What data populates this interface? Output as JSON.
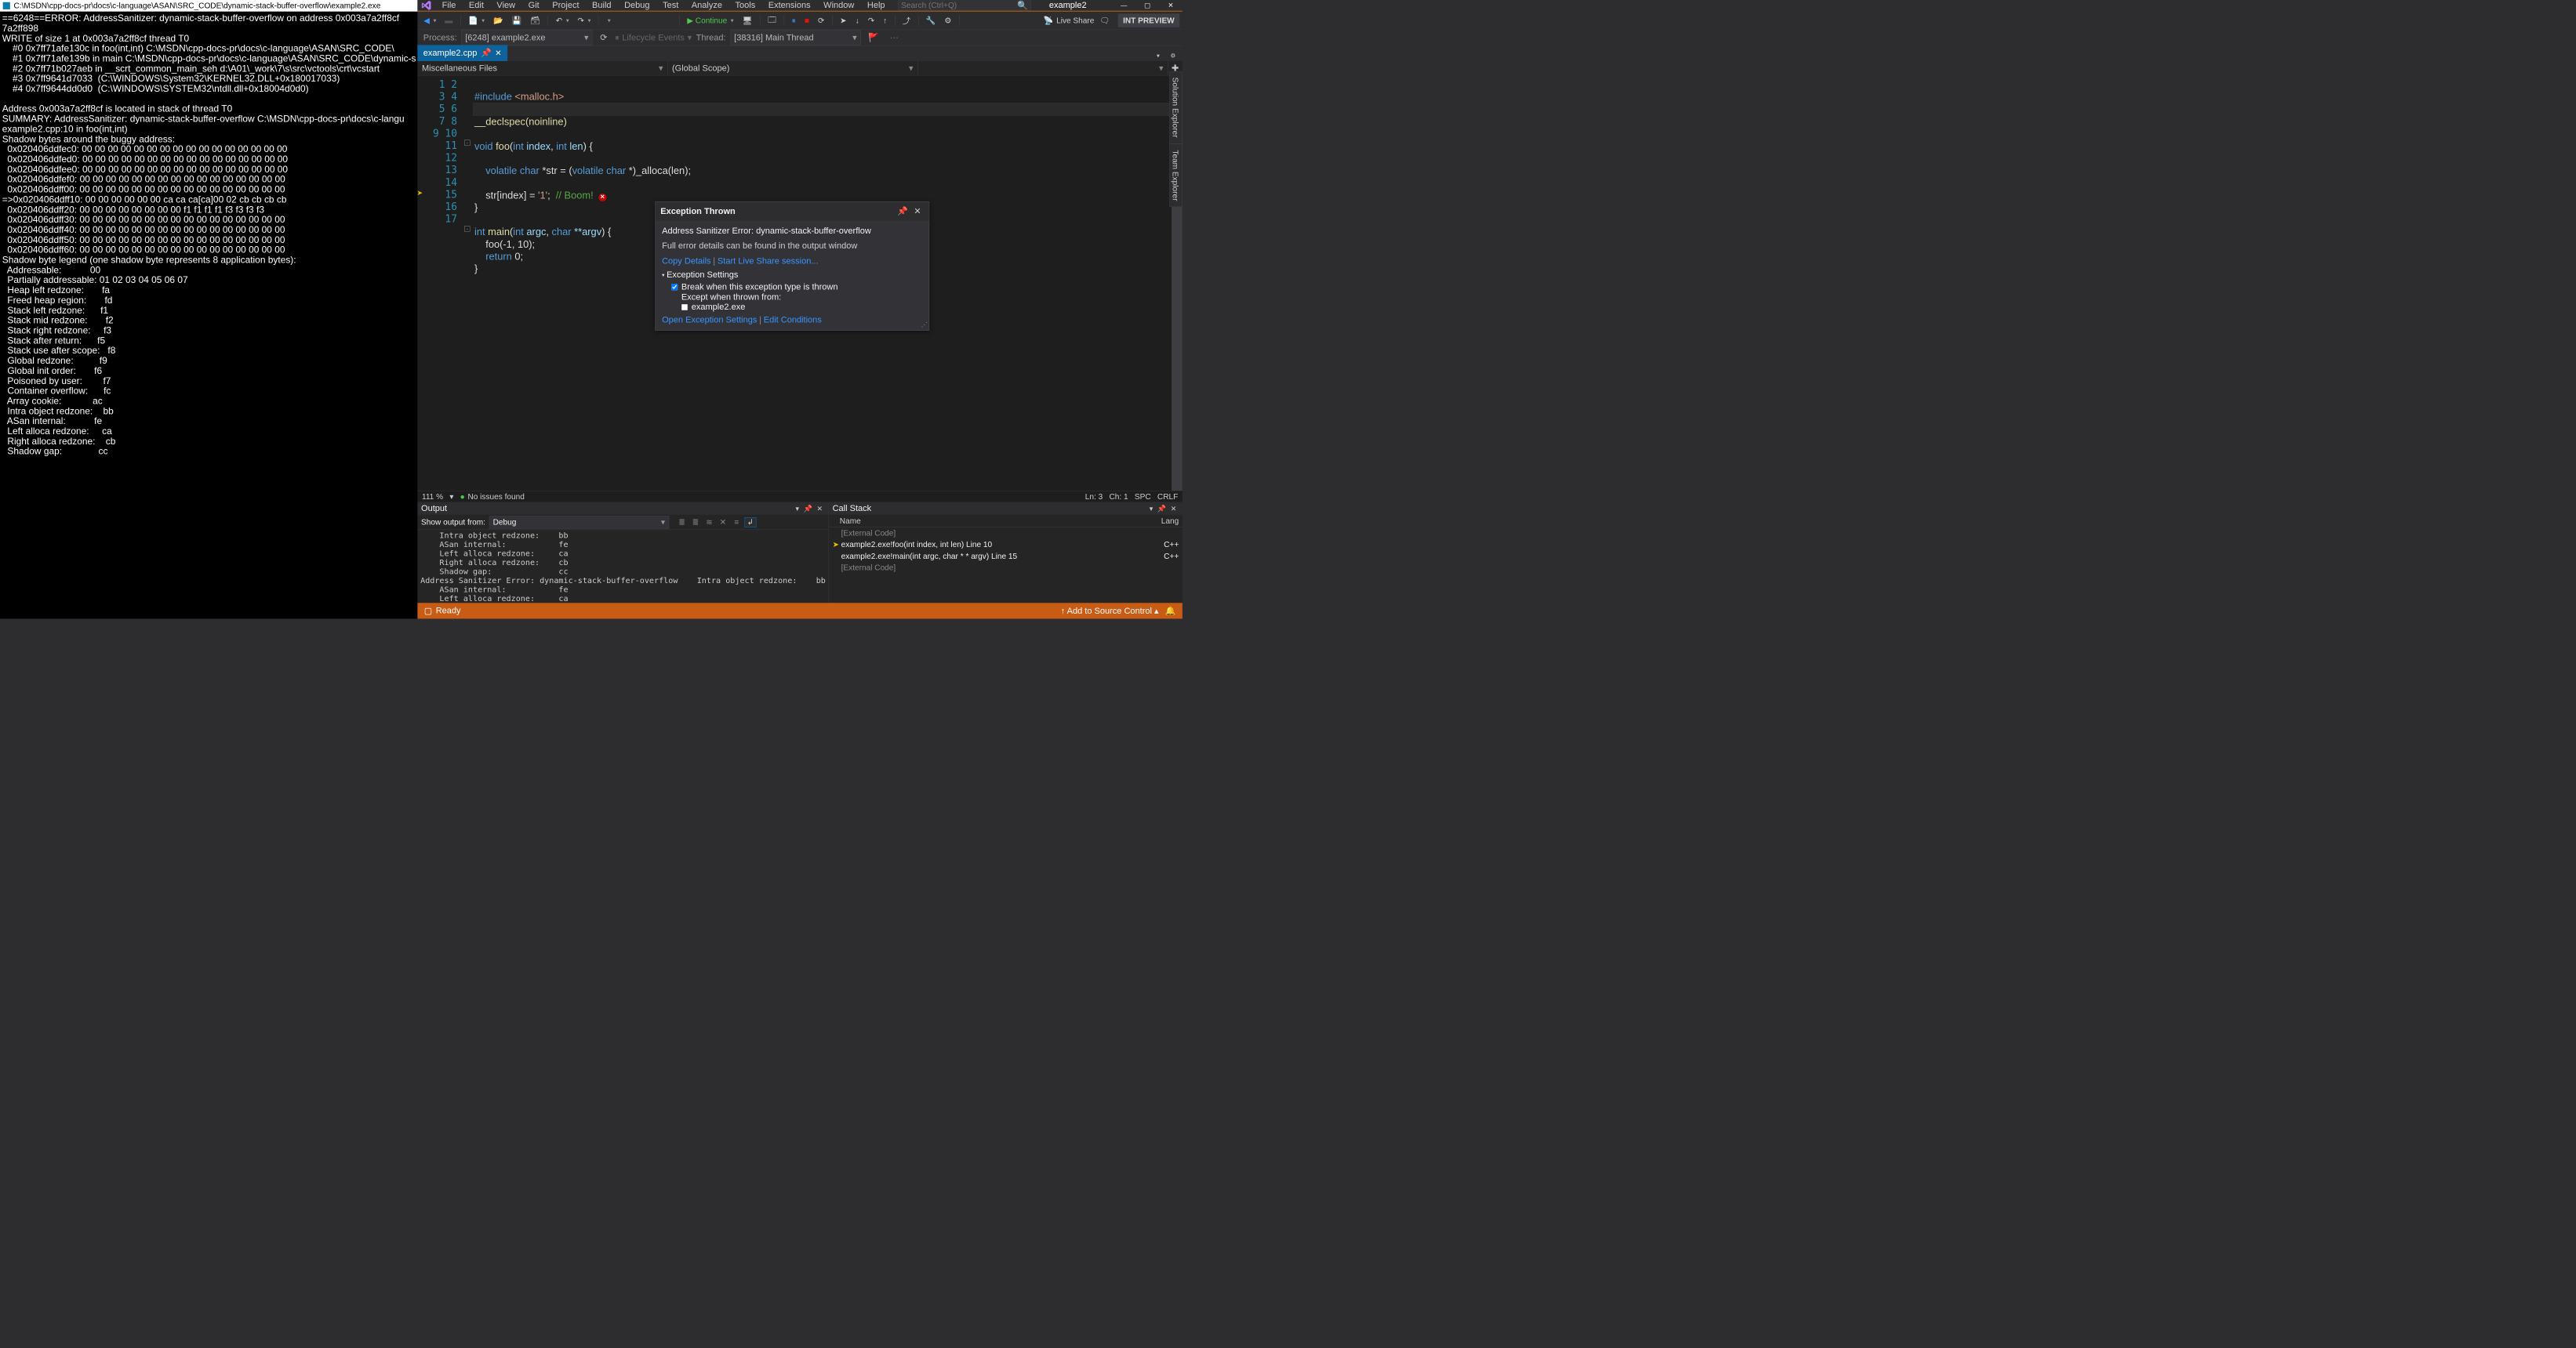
{
  "console": {
    "title": "C:\\MSDN\\cpp-docs-pr\\docs\\c-language\\ASAN\\SRC_CODE\\dynamic-stack-buffer-overflow\\example2.exe",
    "body": "==6248==ERROR: AddressSanitizer: dynamic-stack-buffer-overflow on address 0x003a7a2ff8cf\n7a2ff898\nWRITE of size 1 at 0x003a7a2ff8cf thread T0\n    #0 0x7ff71afe130c in foo(int,int) C:\\MSDN\\cpp-docs-pr\\docs\\c-language\\ASAN\\SRC_CODE\\\n    #1 0x7ff71afe139b in main C:\\MSDN\\cpp-docs-pr\\docs\\c-language\\ASAN\\SRC_CODE\\dynamic-s\n    #2 0x7ff71b027aeb in __scrt_common_main_seh d:\\A01\\_work\\7\\s\\src\\vctools\\crt\\vcstart\n    #3 0x7ff9641d7033  (C:\\WINDOWS\\System32\\KERNEL32.DLL+0x180017033)\n    #4 0x7ff9644dd0d0  (C:\\WINDOWS\\SYSTEM32\\ntdll.dll+0x18004d0d0)\n\nAddress 0x003a7a2ff8cf is located in stack of thread T0\nSUMMARY: AddressSanitizer: dynamic-stack-buffer-overflow C:\\MSDN\\cpp-docs-pr\\docs\\c-langu\nexample2.cpp:10 in foo(int,int)\nShadow bytes around the buggy address:\n  0x020406ddfec0: 00 00 00 00 00 00 00 00 00 00 00 00 00 00 00 00\n  0x020406ddfed0: 00 00 00 00 00 00 00 00 00 00 00 00 00 00 00 00\n  0x020406ddfee0: 00 00 00 00 00 00 00 00 00 00 00 00 00 00 00 00\n  0x020406ddfef0: 00 00 00 00 00 00 00 00 00 00 00 00 00 00 00 00\n  0x020406ddff00: 00 00 00 00 00 00 00 00 00 00 00 00 00 00 00 00\n=>0x020406ddff10: 00 00 00 00 00 00 ca ca ca[ca]00 02 cb cb cb cb\n  0x020406ddff20: 00 00 00 00 00 00 00 00 f1 f1 f1 f1 f3 f3 f3 f3\n  0x020406ddff30: 00 00 00 00 00 00 00 00 00 00 00 00 00 00 00 00\n  0x020406ddff40: 00 00 00 00 00 00 00 00 00 00 00 00 00 00 00 00\n  0x020406ddff50: 00 00 00 00 00 00 00 00 00 00 00 00 00 00 00 00\n  0x020406ddff60: 00 00 00 00 00 00 00 00 00 00 00 00 00 00 00 00\nShadow byte legend (one shadow byte represents 8 application bytes):\n  Addressable:           00\n  Partially addressable: 01 02 03 04 05 06 07\n  Heap left redzone:       fa\n  Freed heap region:       fd\n  Stack left redzone:      f1\n  Stack mid redzone:       f2\n  Stack right redzone:     f3\n  Stack after return:      f5\n  Stack use after scope:   f8\n  Global redzone:          f9\n  Global init order:       f6\n  Poisoned by user:        f7\n  Container overflow:      fc\n  Array cookie:            ac\n  Intra object redzone:    bb\n  ASan internal:           fe\n  Left alloca redzone:     ca\n  Right alloca redzone:    cb\n  Shadow gap:              cc"
  },
  "titlebar": {
    "menus": [
      "File",
      "Edit",
      "View",
      "Git",
      "Project",
      "Build",
      "Debug",
      "Test",
      "Analyze",
      "Tools",
      "Extensions",
      "Window",
      "Help"
    ],
    "search_placeholder": "Search (Ctrl+Q)",
    "window_title": "example2",
    "int_preview": "INT PREVIEW",
    "live_share": "Live Share"
  },
  "toolbar": {
    "continue": "Continue"
  },
  "debugbar": {
    "process_label": "Process:",
    "process_value": "[6248] example2.exe",
    "lifecycle": "Lifecycle Events",
    "thread_label": "Thread:",
    "thread_value": "[38316] Main Thread"
  },
  "tabs": {
    "doc": "example2.cpp"
  },
  "navbar": {
    "left": "Miscellaneous Files",
    "mid": "(Global Scope)",
    "right": ""
  },
  "code": {
    "lines": 17,
    "l2_inc": "#include",
    "l2_file": "<malloc.h>",
    "l4": "__declspec(noinline)",
    "l6_void": "void",
    "l6_foo": "foo",
    "l6_int1": "int",
    "l6_p1": "index",
    "l6_int2": "int",
    "l6_p2": "len",
    "l8_vc": "volatile char",
    "l8_str": "*str = (",
    "l8_vc2": "volatile char",
    "l8_rest": " *)_alloca(len);",
    "l10_a": "str[index] = ",
    "l10_s": "'1'",
    "l10_b": ";",
    "l10_c": "// Boom!",
    "l13_int": "int",
    "l13_main": "main",
    "l13_int2": "int",
    "l13_argc": "argc",
    "l13_char": "char",
    "l13_argv": "**argv",
    "l14": "foo(-1, 10);",
    "l15_ret": "return",
    "l15_v": " 0;"
  },
  "exception": {
    "title": "Exception Thrown",
    "error": "Address Sanitizer Error: dynamic-stack-buffer-overflow",
    "info": "Full error details can be found in the output window",
    "link_copy": "Copy Details",
    "link_live": "Start Live Share session...",
    "settings_title": "Exception Settings",
    "break_label": "Break when this exception type is thrown",
    "except_label": "Except when thrown from:",
    "except_module": "example2.exe",
    "link_open": "Open Exception Settings",
    "link_edit": "Edit Conditions"
  },
  "status": {
    "zoom": "111 %",
    "issues": "No issues found",
    "ln": "Ln: 3",
    "ch": "Ch: 1",
    "spc": "SPC",
    "crlf": "CRLF"
  },
  "output": {
    "title": "Output",
    "from_label": "Show output from:",
    "from_value": "Debug",
    "body": "    Intra object redzone:    bb\n    ASan internal:           fe\n    Left alloca redzone:     ca\n    Right alloca redzone:    cb\n    Shadow gap:              cc\nAddress Sanitizer Error: dynamic-stack-buffer-overflow"
  },
  "callstack": {
    "title": "Call Stack",
    "col_name": "Name",
    "col_lang": "Lang",
    "rows": [
      {
        "name": "[External Code]",
        "lang": "",
        "grey": true,
        "arrow": false
      },
      {
        "name": "example2.exe!foo(int index, int len) Line 10",
        "lang": "C++",
        "grey": false,
        "arrow": true
      },
      {
        "name": "example2.exe!main(int argc, char * * argv) Line 15",
        "lang": "C++",
        "grey": false,
        "arrow": false
      },
      {
        "name": "[External Code]",
        "lang": "",
        "grey": true,
        "arrow": false
      }
    ]
  },
  "footer": {
    "ready": "Ready",
    "source_control": "Add to Source Control"
  },
  "side": {
    "sol": "Solution Explorer",
    "team": "Team Explorer"
  }
}
